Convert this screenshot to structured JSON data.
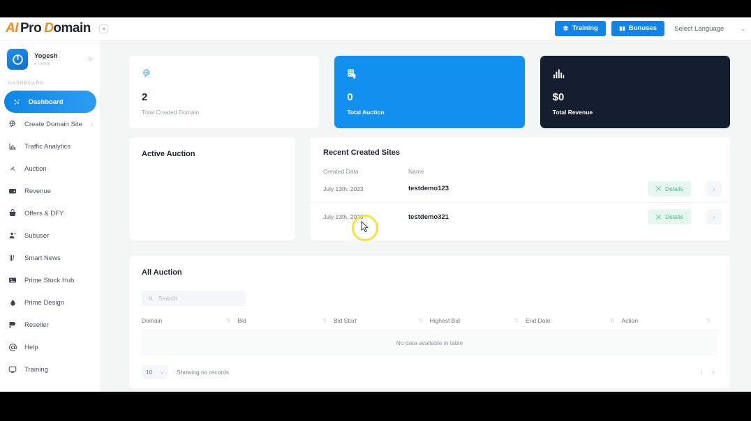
{
  "header": {
    "logo": {
      "part1": "AI",
      "part2": "Pro",
      "part3": "D",
      "part4": "omain"
    },
    "collapse_icon": "chevron-left-icon",
    "training_label": "Training",
    "bonuses_label": "Bonuses",
    "language_label": "Select Language",
    "language_caret": "⌄"
  },
  "sidebar": {
    "profile": {
      "name": "Yogesh",
      "status": "online",
      "gear_icon": "gear-icon"
    },
    "section_label": "DASHBOARD",
    "items": [
      {
        "label": "Dashboard",
        "icon": "dashboard-icon",
        "active": true,
        "chevron": ""
      },
      {
        "label": "Create Domain Site",
        "icon": "globe-icon",
        "active": false,
        "chevron": "›"
      },
      {
        "label": "Traffic Analytics",
        "icon": "bar-chart-icon",
        "active": false,
        "chevron": ""
      },
      {
        "label": "Auction",
        "icon": "gavel-icon",
        "active": false,
        "chevron": ""
      },
      {
        "label": "Revenue",
        "icon": "wallet-icon",
        "active": false,
        "chevron": ""
      },
      {
        "label": "Offers & DFY",
        "icon": "basket-icon",
        "active": false,
        "chevron": ""
      },
      {
        "label": "Subuser",
        "icon": "user-plus-icon",
        "active": false,
        "chevron": ""
      },
      {
        "label": "Smart News",
        "icon": "news-bars-icon",
        "active": false,
        "chevron": ""
      },
      {
        "label": "Prime Stock Hub",
        "icon": "image-icon",
        "active": false,
        "chevron": ""
      },
      {
        "label": "Prime Design",
        "icon": "droplet-icon",
        "active": false,
        "chevron": ""
      },
      {
        "label": "Reseller",
        "icon": "tag-icon",
        "active": false,
        "chevron": ""
      },
      {
        "label": "Help",
        "icon": "at-sign-icon",
        "active": false,
        "chevron": ""
      },
      {
        "label": "Training",
        "icon": "monitor-icon",
        "active": false,
        "chevron": ""
      }
    ]
  },
  "stats": [
    {
      "value": "2",
      "label": "Total Created Domain",
      "icon": "globe-icon",
      "theme": "light"
    },
    {
      "value": "0",
      "label": "Total Auction",
      "icon": "auction-list-icon",
      "theme": "blue"
    },
    {
      "value": "$0",
      "label": "Total Revenue",
      "icon": "bar-chart-icon",
      "theme": "dark"
    }
  ],
  "active_auction": {
    "title": "Active Auction"
  },
  "recent_sites": {
    "title": "Recent Created Sites",
    "columns": [
      "Created Data",
      "Name"
    ],
    "rows": [
      {
        "date": "July 13th, 2023",
        "name": "testdemo123",
        "details_label": "Details",
        "details_icon": "shuffle-icon",
        "chevron": "›"
      },
      {
        "date": "July 13th, 2023",
        "name": "testdemo321",
        "details_label": "Details",
        "details_icon": "shuffle-icon",
        "chevron": "›"
      }
    ]
  },
  "all_auction": {
    "title": "All Auction",
    "search": {
      "placeholder": "Search",
      "value": "",
      "icon": "search-icon"
    },
    "columns": [
      "Domain",
      "Bid",
      "Bid Start",
      "Highest Bid",
      "End Date",
      "Action"
    ],
    "sort_icon": "⇅",
    "empty_message": "No data available in table",
    "page_size": "10",
    "page_size_caret": "⌄",
    "showing_text": "Showing no records",
    "prev_label": "‹",
    "next_label": "›"
  },
  "colors": {
    "accent_blue": "#1190f0",
    "dark_card": "#151e2e",
    "details_green": "#3fb88a",
    "details_bg": "#e6f7ef",
    "logo_orange": "#f08a1d",
    "highlight_yellow": "#f2e43a",
    "page_bg": "#f3f6f5"
  }
}
